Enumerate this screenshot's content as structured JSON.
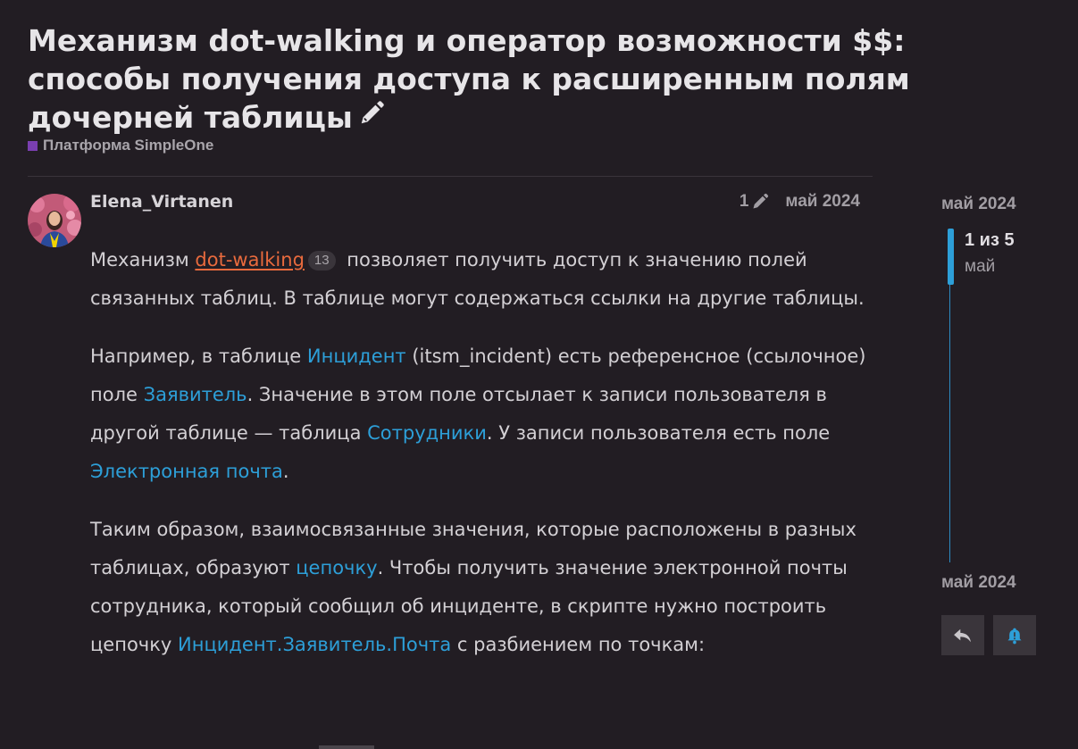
{
  "topic": {
    "title": "Механизм dot-walking и оператор возможности $$: способы получения доступа к расширенным полям дочерней таблицы",
    "category": "Платформа SimpleOne",
    "category_color": "#7a3fb0"
  },
  "post": {
    "author": "Elena_Virtanen",
    "edit_count": "1",
    "date": "май 2024",
    "p1": {
      "before": "Механизм ",
      "link": "dot-walking",
      "link_clicks": "13",
      "after": " позволяет получить доступ к значению полей связанных таблиц. В таблице могут содержаться ссылки на другие таблицы."
    },
    "p2": {
      "t1": "Например, в таблице ",
      "l1": "Инцидент",
      "t2": " (itsm_incident) есть референсное (ссылочное) поле ",
      "l2": "Заявитель",
      "t3": ". Значение в этом поле отсылает к записи пользователя в другой таблице — таблица ",
      "l3": "Сотрудники",
      "t4": ". У записи пользователя есть поле ",
      "l4": "Электронная почта",
      "t5": "."
    },
    "p3": {
      "t1": "Таким образом, взаимосвязанные значения, которые расположены в разных таблицах, образуют ",
      "l1": "цепочку",
      "t2": ". Чтобы получить значение электронной почты сотрудника, который сообщил об инциденте, в скрипте нужно построить цепочку ",
      "l2": "Инцидент.Заявитель.Почта",
      "t3": " с разбиением по точкам:"
    }
  },
  "timeline": {
    "top_date": "май 2024",
    "position": "1 из 5",
    "month": "май",
    "bottom_date": "май 2024",
    "reply_icon": "reply-icon",
    "notify_icon": "bell-icon"
  },
  "colors": {
    "background": "#221d23",
    "link": "#2d9fd8",
    "accent_link": "#e86a3d"
  }
}
